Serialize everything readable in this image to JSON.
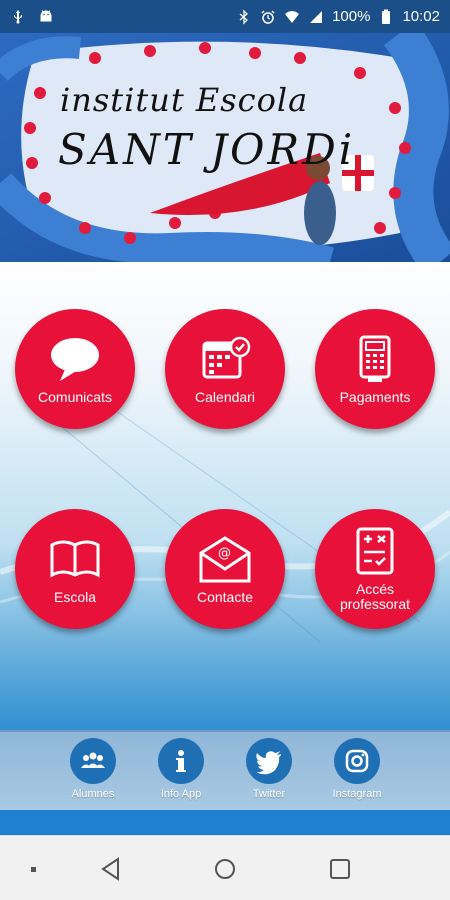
{
  "status_bar": {
    "battery": "100%",
    "time": "10:02",
    "left_icons": [
      "usb-icon",
      "android-icon"
    ],
    "right_icons": [
      "bluetooth-icon",
      "alarm-icon",
      "wifi-icon",
      "signal-icon",
      "battery-icon"
    ]
  },
  "banner": {
    "line1": "institut Escola",
    "line2": "SANT JORDi"
  },
  "tiles": [
    {
      "label": "Comunicats",
      "icon": "speech-bubble-icon"
    },
    {
      "label": "Calendari",
      "icon": "calendar-icon"
    },
    {
      "label": "Pagaments",
      "icon": "card-terminal-icon"
    },
    {
      "label": "Escola",
      "icon": "open-book-icon"
    },
    {
      "label": "Contacte",
      "icon": "envelope-icon"
    },
    {
      "label": "Accés professorat",
      "icon": "checklist-icon"
    }
  ],
  "social": [
    {
      "label": "Alumnes",
      "icon": "students-icon"
    },
    {
      "label": "Info App",
      "icon": "info-icon"
    },
    {
      "label": "Twitter",
      "icon": "twitter-icon"
    },
    {
      "label": "Instagram",
      "icon": "instagram-icon"
    }
  ],
  "colors": {
    "tile_red": "#e8113a",
    "status_bar": "#1b4f8a",
    "social_circle": "#1f6fb4"
  }
}
